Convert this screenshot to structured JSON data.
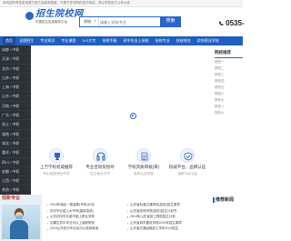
{
  "topbar": {
    "notice": "本网站所有信息来源于官方及新闻报道，不属于任何院校官方网站，请以学校官方公布为准"
  },
  "logo": {
    "name": "招生院校网",
    "sub": "中国招生信息服务平台"
  },
  "search": {
    "scope": "学校",
    "placeholder": "请输入学校/专业",
    "button": "搜索"
  },
  "phone": {
    "number": "0535-"
  },
  "nav": {
    "items": [
      "首页",
      "全国招生",
      "专业知识",
      "专业课程",
      "3+2大专",
      "技校手册",
      "初中毕业上技校",
      "技校专业",
      "技校排名",
      "综合职业学校"
    ]
  },
  "sidebar": {
    "items": [
      "成都 / 中职",
      "天津 / 中职",
      "北京 / 中职",
      "江苏 / 中职",
      "上海 / 中职",
      "山东 / 中职",
      "河南 / 中职",
      "广东 / 中职",
      "浙江 / 中职",
      "湖南 / 中职",
      "湖北 / 中职",
      "重庆 / 中职",
      "四川 / 中职",
      "安徽 / 中职",
      "江西 / 中职",
      "其他 / 中职"
    ]
  },
  "rightcol": {
    "title": "院校推荐",
    "links": [
      "院校一",
      "院校二",
      "院校三",
      "院校四",
      "院校五",
      "院校六",
      "院校七",
      "院校八",
      "院校九"
    ]
  },
  "features": [
    {
      "title": "上万学校权威推荐",
      "sub": "专业/校园/资历/环境"
    },
    {
      "title": "专业咨询及指导",
      "sub": "招生/就业/升学"
    },
    {
      "title": "学校资质审核(审)",
      "sub": "资质/认证/质量"
    },
    {
      "title": "权威平台，品牌认证",
      "sub": "品牌/平台/认证"
    }
  ],
  "bottom": {
    "left_heading": "招新专业",
    "news_a": [
      "2019年湖北一般高职(专科)计划",
      "初中毕业能上大专吗(直接招收)",
      "山东初中毕业能不能上职业学校",
      "如果生初中毕业可以上高职院校",
      "2019山东初中毕业后可以选择就读"
    ],
    "news_b": [
      "山东省轨道交通学校(技校)招生简章",
      "山东省技师学院(技校)招生计划书",
      "2019年山东省技工院校招生计划",
      "山东省城市建设学校2019年招生简章",
      "山东省交通运输技工学校2019招生"
    ],
    "right_heading": "推荐新闻"
  }
}
